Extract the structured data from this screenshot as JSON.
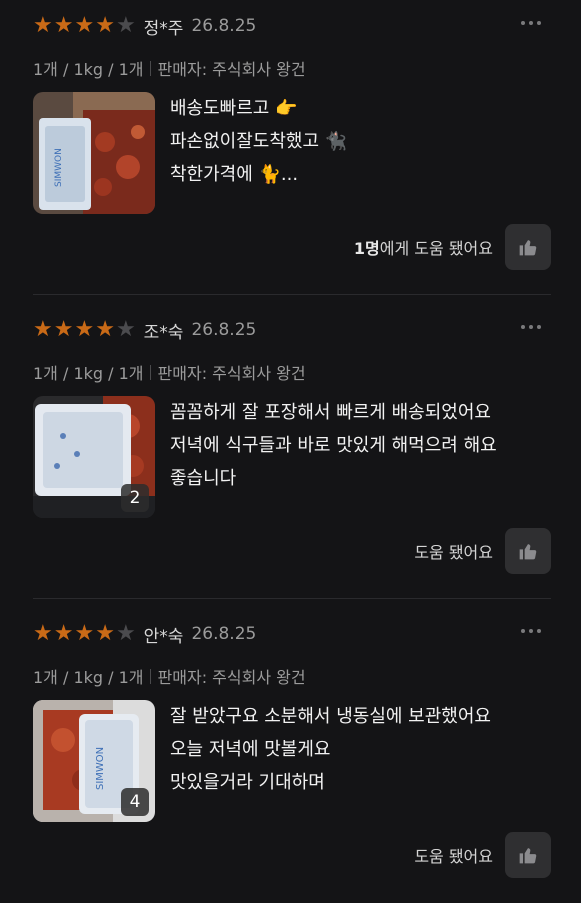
{
  "reviews": [
    {
      "rating": 4,
      "author": "정*주",
      "date": "26.8.25",
      "option": "1개 / 1kg / 1개",
      "seller": "판매자: 주식회사 왕건",
      "text_lines": [
        "배송도빠르고 👉",
        "파손없이잘도착했고 🐈‍⬛",
        "착한가격에 🐈..."
      ],
      "helpful_count": "1명",
      "helpful_label": "에게 도움 됐어요",
      "image_count": ""
    },
    {
      "rating": 4,
      "author": "조*숙",
      "date": "26.8.25",
      "option": "1개 / 1kg / 1개",
      "seller": "판매자: 주식회사 왕건",
      "text_lines": [
        "꼼꼼하게 잘 포장해서 빠르게 배송되었어요",
        "저녁에 식구들과  바로 맛있게  해먹으려 해요",
        "좋습니다"
      ],
      "helpful_count": "",
      "helpful_label": "도움 됐어요",
      "image_count": "2"
    },
    {
      "rating": 4,
      "author": "안*숙",
      "date": "26.8.25",
      "option": "1개 / 1kg / 1개",
      "seller": "판매자: 주식회사 왕건",
      "text_lines": [
        "잘  받았구요 소분해서 냉동실에 보관했어요",
        "오늘 저녁에 맛볼게요",
        "맛있을거라 기대하며"
      ],
      "helpful_count": "",
      "helpful_label": "도움 됐어요",
      "image_count": "4"
    }
  ],
  "icons": {
    "star": "star-icon",
    "more": "more-dots-icon",
    "helpful": "thumbs-up-icon"
  },
  "colors": {
    "background": "#141416",
    "star_on": "#c96a17",
    "star_off": "#4b4b4e",
    "muted_text": "#9b9b9b",
    "button_bg": "#2f2f31"
  }
}
